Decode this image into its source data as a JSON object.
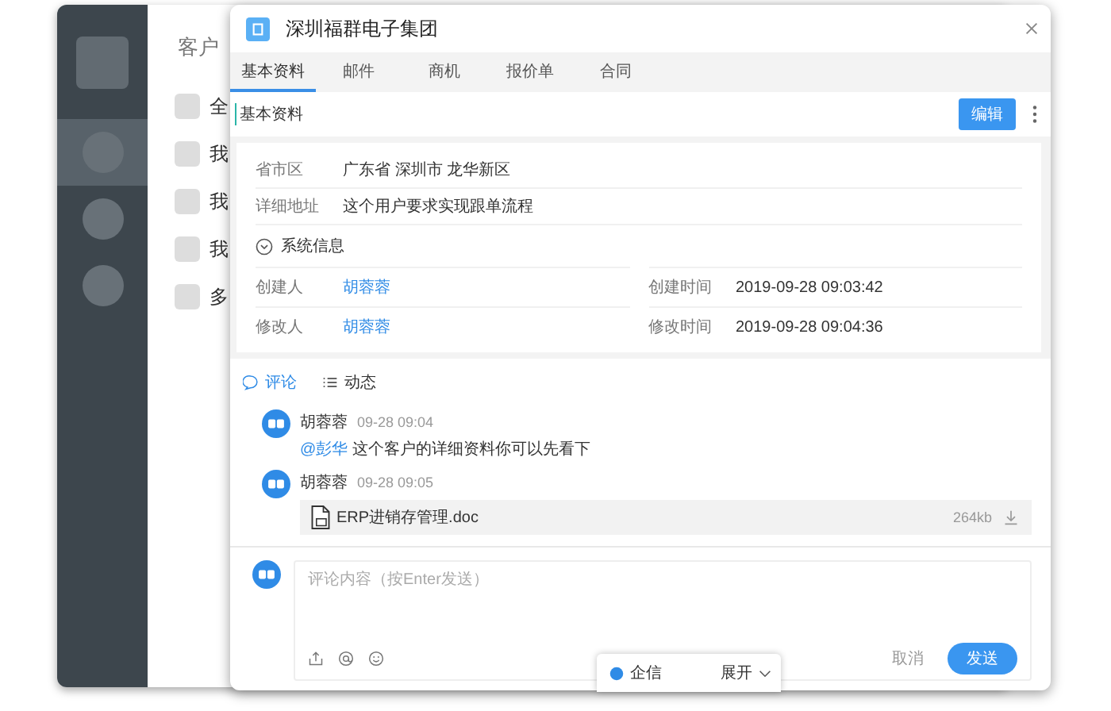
{
  "sidebar": {
    "items": [
      {
        "kind": "logo",
        "selected": false
      },
      {
        "kind": "nav",
        "selected": true
      },
      {
        "kind": "nav",
        "selected": false
      },
      {
        "kind": "nav",
        "selected": false
      }
    ]
  },
  "page": {
    "title": "客户",
    "filters": [
      {
        "label": "全",
        "checked": false
      },
      {
        "label": "我",
        "checked": false
      },
      {
        "label": "我",
        "checked": false
      },
      {
        "label": "我",
        "checked": false
      },
      {
        "label": "多",
        "checked": false
      }
    ]
  },
  "dialog": {
    "title": "深圳福群电子集团",
    "tabs": [
      {
        "label": "基本资料",
        "selected": true
      },
      {
        "label": "邮件",
        "selected": false
      },
      {
        "label": "商机",
        "selected": false
      },
      {
        "label": "报价单",
        "selected": false
      },
      {
        "label": "合同",
        "selected": false
      }
    ],
    "section_title": "基本资料",
    "edit_button": "编辑",
    "fields": [
      {
        "label": "省市区",
        "value": "广东省 深圳市 龙华新区"
      },
      {
        "label": "详细地址",
        "value": "这个用户要求实现跟单流程"
      }
    ],
    "system_info": {
      "title": "系统信息",
      "expanded": true,
      "fields": [
        {
          "label": "创建人",
          "value": "胡蓉蓉",
          "kind": "user"
        },
        {
          "label": "创建时间",
          "value": "2019-09-28 09:03:42",
          "kind": "text"
        },
        {
          "label": "修改人",
          "value": "胡蓉蓉",
          "kind": "user"
        },
        {
          "label": "修改时间",
          "value": "2019-09-28 09:04:36",
          "kind": "text"
        }
      ]
    },
    "activity_tabs": [
      {
        "label": "评论",
        "kind": "comment",
        "selected": true
      },
      {
        "label": "动态",
        "kind": "list",
        "selected": false
      }
    ],
    "comments": [
      {
        "author": "胡蓉蓉",
        "time": "09-28 09:04",
        "kind": "text",
        "mention": "@彭华",
        "text": "这个客户的详细资料你可以先看下"
      },
      {
        "author": "胡蓉蓉",
        "time": "09-28 09:05",
        "kind": "file",
        "file": {
          "name": "ERP进销存管理.doc",
          "size": "264kb"
        }
      }
    ],
    "composer": {
      "placeholder": "评论内容（按Enter发送）",
      "cancel": "取消",
      "send": "发送"
    }
  },
  "chat_bar": {
    "title": "企信",
    "toggle": "展开"
  }
}
